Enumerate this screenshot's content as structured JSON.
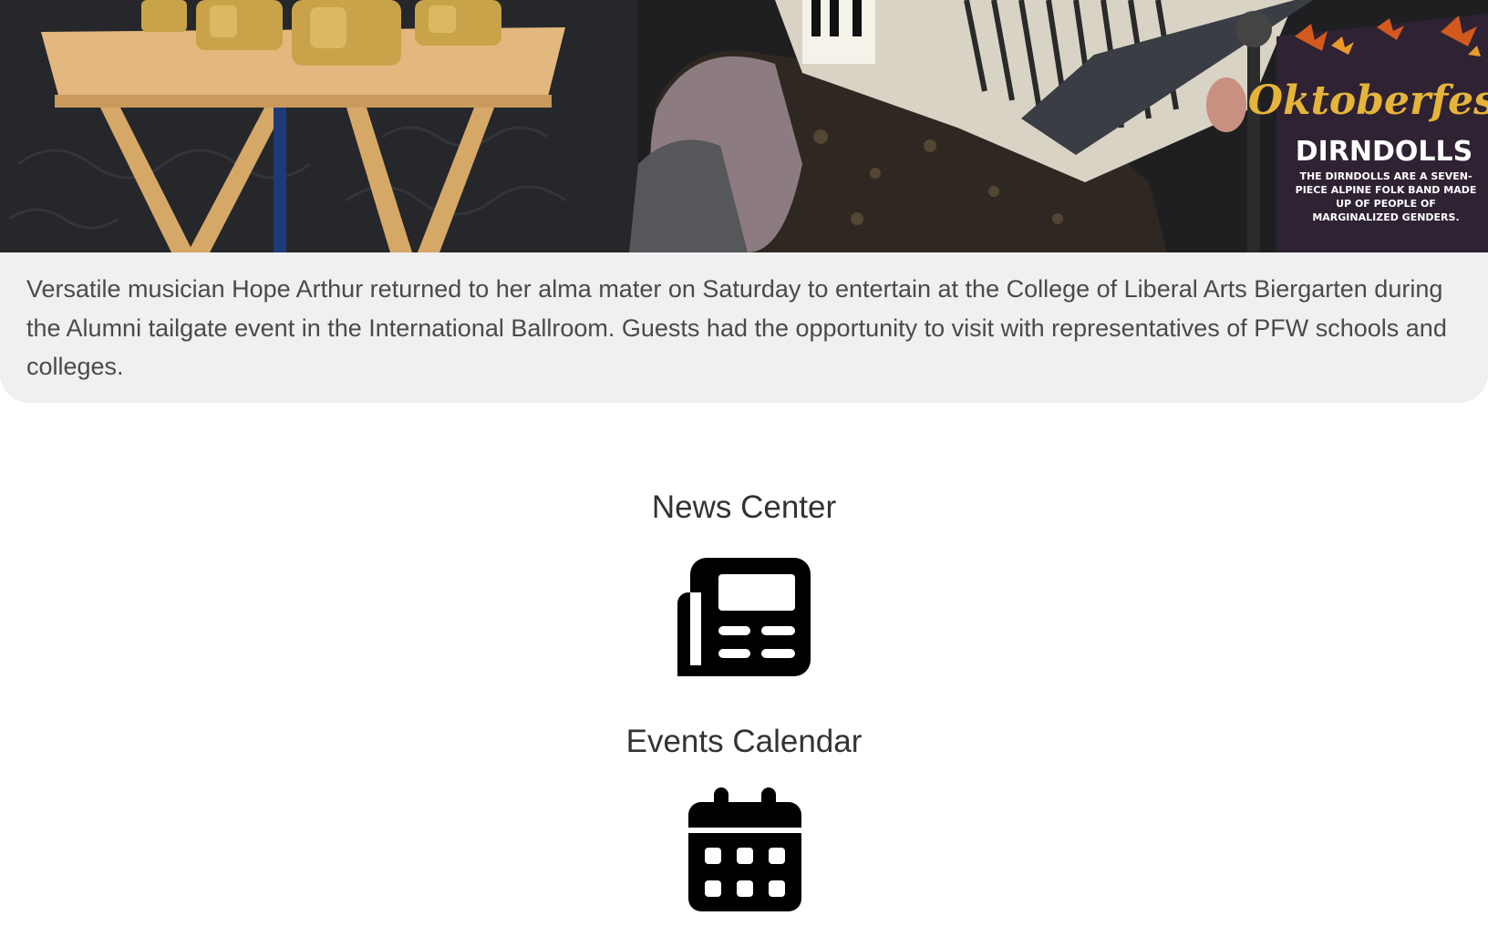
{
  "photo": {
    "poster_title": "Oktoberfest",
    "poster_band": "DIRNDOLLS",
    "poster_tagline": "THE DIRNDOLLS ARE A SEVEN-PIECE ALPINE FOLK BAND MADE UP OF PEOPLE OF MARGINALIZED GENDERS."
  },
  "caption": "Versatile musician Hope Arthur returned to her alma mater on Saturday to entertain at the College of Liberal Arts Biergarten during the Alumni tailgate event in the International Ballroom. Guests had the opportunity to visit with representatives of PFW schools and colleges.",
  "links": {
    "news_center": {
      "label": "News Center",
      "icon": "newspaper-icon"
    },
    "events_calendar": {
      "label": "Events Calendar",
      "icon": "calendar-icon"
    }
  },
  "colors": {
    "caption_background": "#f0f0f0",
    "icon": "#000000",
    "heading": "#333333"
  }
}
